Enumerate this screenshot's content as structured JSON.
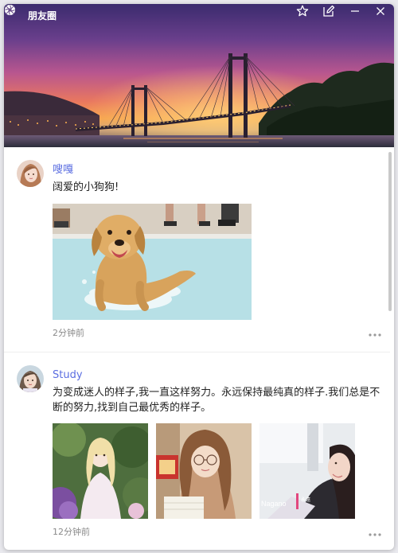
{
  "app": {
    "title": "朋友圈"
  },
  "titlebar": {
    "buttons": [
      {
        "name": "favorite",
        "icon": "star-icon"
      },
      {
        "name": "compose",
        "icon": "edit-icon"
      },
      {
        "name": "minimize",
        "icon": "minimize-icon"
      },
      {
        "name": "close",
        "icon": "close-icon"
      }
    ]
  },
  "posts": [
    {
      "username": "嗖嘎",
      "text": "阔爱的小狗狗!",
      "time": "2分钟前",
      "photos": [
        "golden-retriever-in-pool"
      ]
    },
    {
      "username": "Study",
      "text": "为变成迷人的样子,我一直这样努力。永远保持最纯真的样子.我们总是不断的努力,找到自己最优秀的样子。",
      "time": "12分钟前",
      "photos": [
        "girl-in-lolita-dress",
        "girl-with-glasses",
        "girl-portrait"
      ],
      "photo_caption": "Nagano"
    }
  ],
  "colors": {
    "username": "#5b6ee1",
    "text": "#222222",
    "meta": "#8a8a8a"
  }
}
